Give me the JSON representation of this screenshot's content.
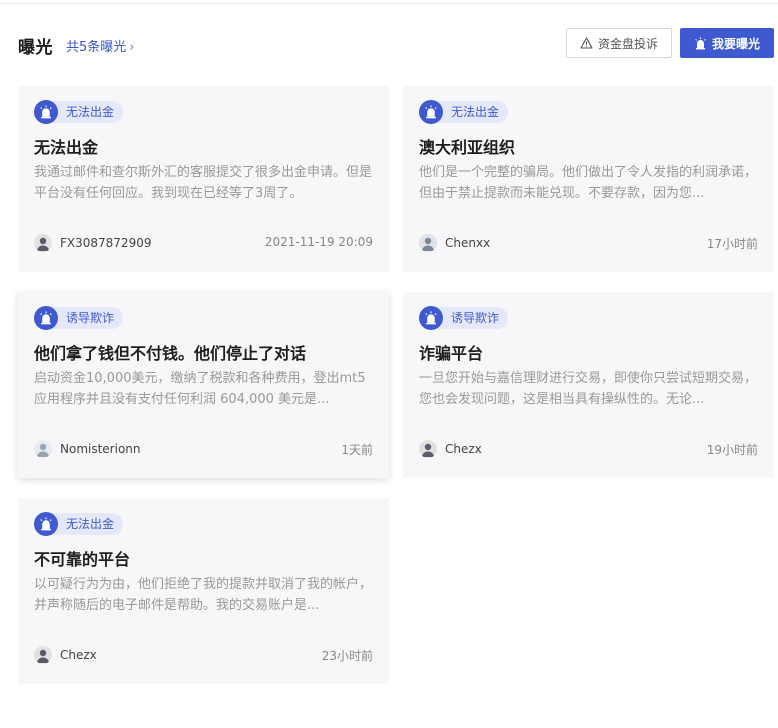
{
  "header": {
    "title": "曝光",
    "count_link": "共5条曝光",
    "complaint_button": "资金盘投诉",
    "expose_button": "我要曝光"
  },
  "colors": {
    "accent": "#3f5ad0",
    "tag_bg": "#e4e8f8",
    "card_bg": "#f7f7f9"
  },
  "cards": [
    {
      "tag": "无法出金",
      "title": "无法出金",
      "desc": "我通过邮件和查尔斯外汇的客服提交了很多出金申请。但是平台没有任何回应。我到现在已经等了3周了。",
      "user": "FX3087872909",
      "time": "2021-11-19 20:09"
    },
    {
      "tag": "无法出金",
      "title": "澳大利亚组织",
      "desc": "他们是一个完整的骗局。他们做出了令人发指的利润承诺，但由于禁止提款而未能兑现。不要存款，因为您...",
      "user": "Chenxx",
      "time": "17小时前"
    },
    {
      "tag": "诱导欺诈",
      "title": "他们拿了钱但不付钱。他们停止了对话",
      "desc": "启动资金10,000美元，缴纳了税款和各种费用，登出mt5应用程序并且没有支付任何利润 604,000 美元是...",
      "user": "Nomisterionn",
      "time": "1天前"
    },
    {
      "tag": "诱导欺诈",
      "title": "诈骗平台",
      "desc": "一旦您开始与嘉信理财进行交易，即使你只尝试短期交易，您也会发现问题，这是相当具有操纵性的。无论...",
      "user": "Chezx",
      "time": "19小时前"
    },
    {
      "tag": "无法出金",
      "title": "不可靠的平台",
      "desc": "以可疑行为为由，他们拒绝了我的提款并取消了我的帐户，并声称随后的电子邮件是帮助。我的交易账户是...",
      "user": "Chezx",
      "time": "23小时前"
    }
  ]
}
